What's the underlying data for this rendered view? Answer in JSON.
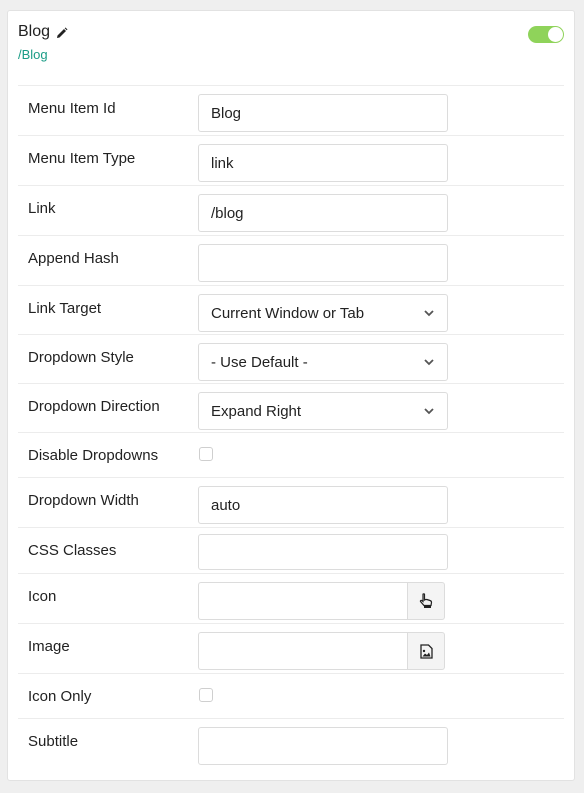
{
  "header": {
    "title": "Blog",
    "path": "/Blog",
    "enabled": true,
    "accent_color": "#8fd35a",
    "path_color": "#1a9c86"
  },
  "fields": {
    "menu_item_id": {
      "label": "Menu Item Id",
      "value": "Blog"
    },
    "menu_item_type": {
      "label": "Menu Item Type",
      "value": "link"
    },
    "link": {
      "label": "Link",
      "value": "/blog"
    },
    "append_hash": {
      "label": "Append Hash",
      "value": ""
    },
    "link_target": {
      "label": "Link Target",
      "value": "Current Window or Tab"
    },
    "dropdown_style": {
      "label": "Dropdown Style",
      "value": "- Use Default -"
    },
    "dropdown_direction": {
      "label": "Dropdown Direction",
      "value": "Expand Right"
    },
    "disable_dropdowns": {
      "label": "Disable Dropdowns",
      "checked": false
    },
    "dropdown_width": {
      "label": "Dropdown Width",
      "value": "auto"
    },
    "css_classes": {
      "label": "CSS Classes",
      "value": ""
    },
    "icon": {
      "label": "Icon",
      "value": "",
      "button_icon": "hand-pointer-icon"
    },
    "image": {
      "label": "Image",
      "value": "",
      "button_icon": "image-file-icon"
    },
    "icon_only": {
      "label": "Icon Only",
      "checked": false
    },
    "subtitle": {
      "label": "Subtitle",
      "value": ""
    }
  }
}
